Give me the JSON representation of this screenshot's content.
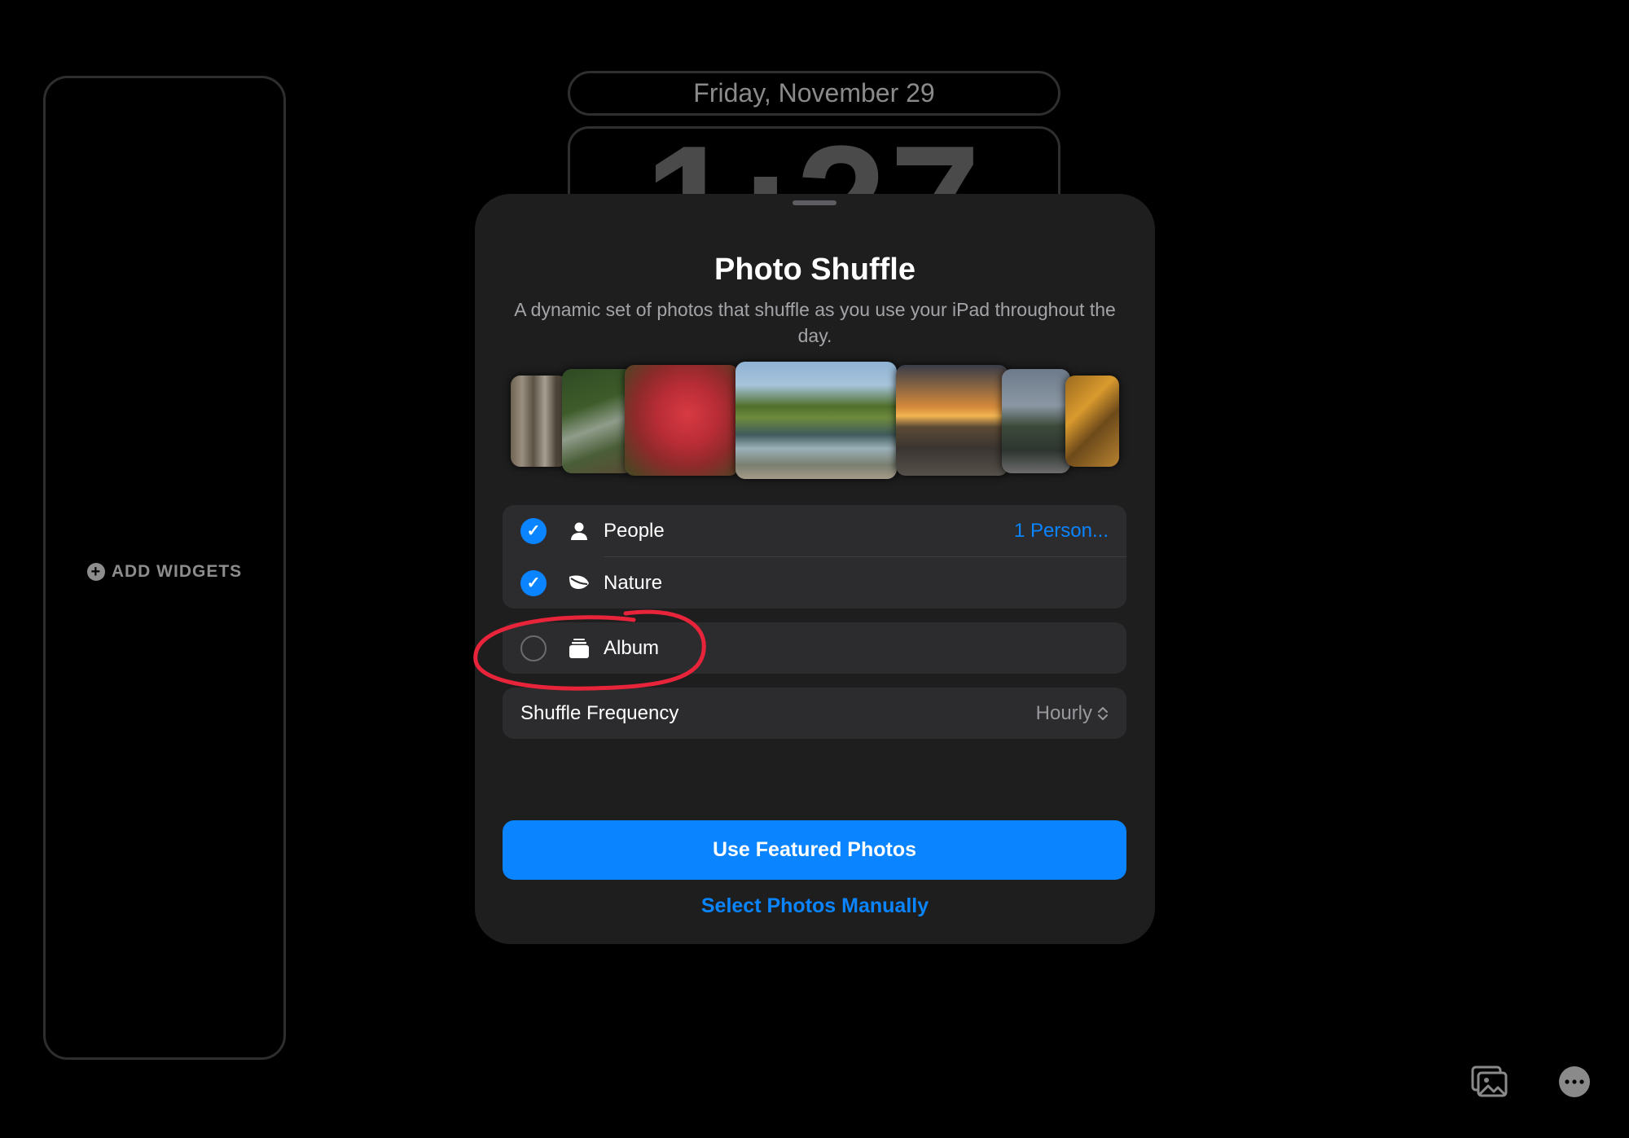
{
  "lock_screen": {
    "add_widgets_label": "ADD WIDGETS",
    "date": "Friday, November 29",
    "time": "1:27"
  },
  "sheet": {
    "title": "Photo Shuffle",
    "subtitle": "A dynamic set of photos that shuffle as you use your iPad throughout the day.",
    "photos": [
      "forest-trees",
      "waterfall-hillside",
      "red-autumn-leaves",
      "pond-landscape",
      "sunset-field",
      "road-dusk",
      "rock-waterfall"
    ],
    "options": [
      {
        "label": "People",
        "icon": "person-icon",
        "checked": true,
        "detail": "1 Person..."
      },
      {
        "label": "Nature",
        "icon": "leaf-icon",
        "checked": true
      },
      {
        "label": "Album",
        "icon": "album-stack-icon",
        "checked": false
      }
    ],
    "frequency": {
      "label": "Shuffle Frequency",
      "value": "Hourly"
    },
    "primary_button": "Use Featured Photos",
    "secondary_button": "Select Photos Manually"
  },
  "colors": {
    "accent": "#0a84ff",
    "sheet_bg": "#1e1e1f",
    "row_bg": "#2c2c2e",
    "annotation": "#e8243b"
  },
  "toolbar": {
    "icons": [
      "gallery-icon",
      "more-icon"
    ]
  }
}
